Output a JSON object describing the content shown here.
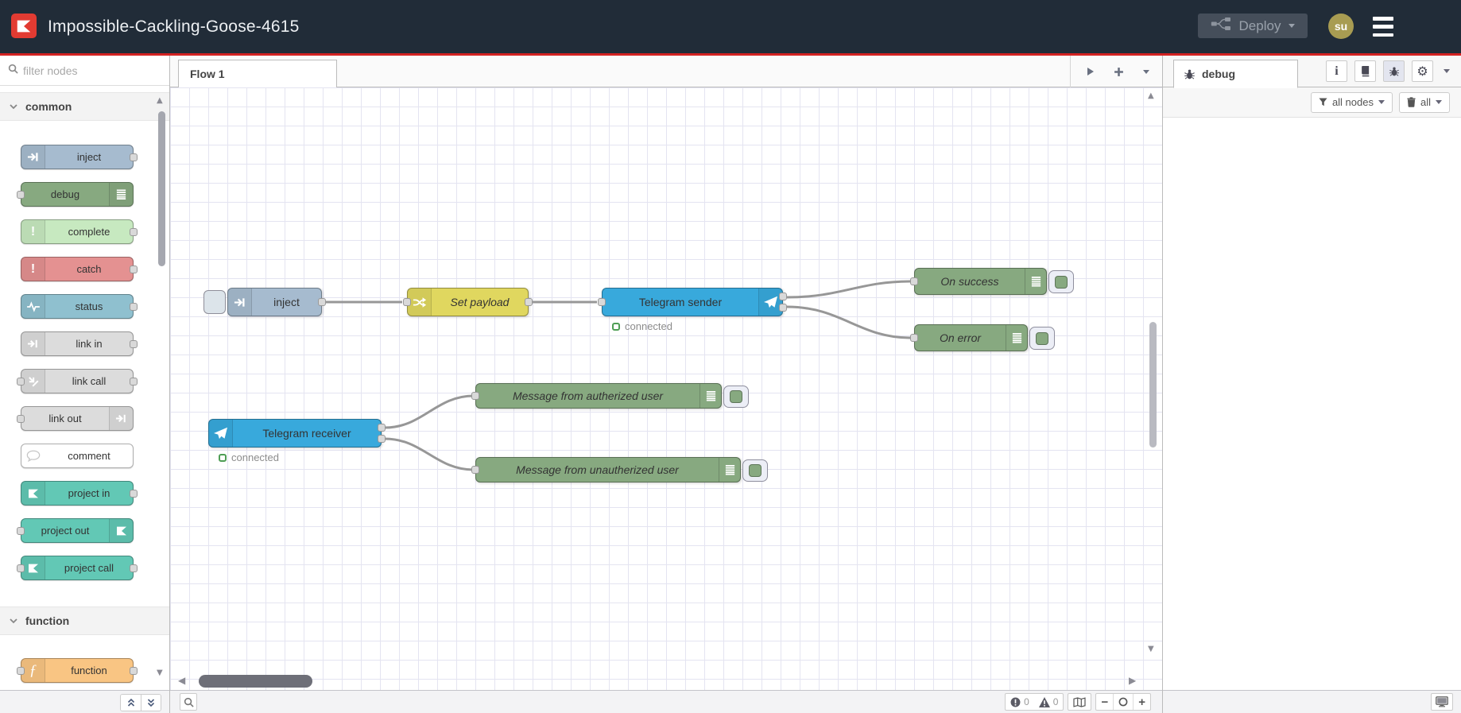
{
  "header": {
    "title": "Impossible-Cackling-Goose-4615",
    "deploy_label": "Deploy",
    "user_initials": "su"
  },
  "palette": {
    "search_placeholder": "filter nodes",
    "categories": [
      {
        "label": "common",
        "nodes": [
          {
            "label": "inject",
            "color": "#a6bbcf"
          },
          {
            "label": "debug",
            "color": "#87a980"
          },
          {
            "label": "complete",
            "color": "#c7e9c0"
          },
          {
            "label": "catch",
            "color": "#e49191"
          },
          {
            "label": "status",
            "color": "#8fc0cf"
          },
          {
            "label": "link in",
            "color": "#dcdcdc"
          },
          {
            "label": "link call",
            "color": "#dcdcdc"
          },
          {
            "label": "link out",
            "color": "#dcdcdc"
          },
          {
            "label": "comment",
            "color": "#ffffff"
          },
          {
            "label": "project in",
            "color": "#62c8b5"
          },
          {
            "label": "project out",
            "color": "#62c8b5"
          },
          {
            "label": "project call",
            "color": "#62c8b5"
          }
        ]
      },
      {
        "label": "function",
        "nodes": [
          {
            "label": "function",
            "color": "#f9c583"
          }
        ]
      }
    ]
  },
  "workspace": {
    "tab_label": "Flow 1",
    "nodes": [
      {
        "label": "inject",
        "type": "inject",
        "color": "#a6bbcf",
        "italic": false
      },
      {
        "label": "Set payload",
        "type": "change",
        "color": "#e0d75f",
        "italic": true
      },
      {
        "label": "Telegram sender",
        "type": "telegram-sender",
        "color": "#38a9dc",
        "italic": false,
        "status": "connected"
      },
      {
        "label": "On success",
        "type": "debug",
        "color": "#87a980",
        "italic": true
      },
      {
        "label": "On error",
        "type": "debug",
        "color": "#87a980",
        "italic": true
      },
      {
        "label": "Telegram receiver",
        "type": "telegram-receiver",
        "color": "#38a9dc",
        "italic": false,
        "status": "connected"
      },
      {
        "label": "Message from autherized user",
        "type": "debug",
        "color": "#87a980",
        "italic": true
      },
      {
        "label": "Message from unautherized user",
        "type": "debug",
        "color": "#87a980",
        "italic": true
      }
    ]
  },
  "sidebar": {
    "tab_label": "debug",
    "filter_label": "all nodes",
    "clear_label": "all"
  },
  "canvas_footer": {
    "error_count": "0",
    "warning_count": "0",
    "zoom_out_label": "−",
    "zoom_in_label": "+"
  },
  "icons": {
    "exclamation": "!",
    "function_glyph": "ƒ",
    "info_glyph": "i",
    "gear_glyph": "⚙",
    "scroll_up": "▲",
    "scroll_down": "▼",
    "scroll_left": "◀",
    "scroll_right": "▶"
  },
  "colors": {
    "header_bg": "#212c38",
    "accent_red": "#d32222",
    "logo_red": "#e23b32",
    "deploy_bg": "#454e5a",
    "avatar_bg": "#a89c52",
    "wire": "#979797",
    "grid_line": "#e4e4f1",
    "debug_green": "#87a980",
    "telegram_blue": "#38a9dc",
    "change_yellow": "#e0d75f",
    "inject_blue": "#a6bbcf",
    "status_green": "#4f9e55"
  }
}
